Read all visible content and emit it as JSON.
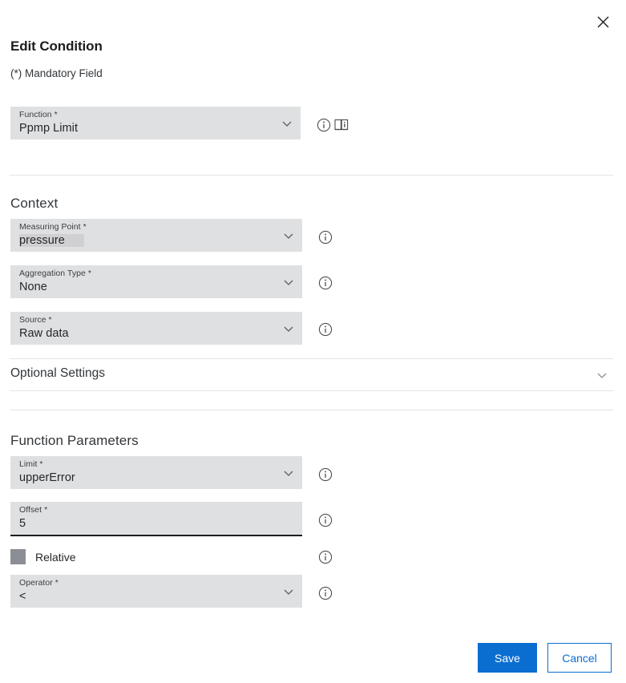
{
  "dialog": {
    "title": "Edit Condition",
    "mandatory_note": "(*) Mandatory Field",
    "close_label": "Close"
  },
  "function_field": {
    "label": "Function *",
    "value": "Ppmp Limit",
    "info_icon": "info-icon",
    "doc_icon": "documentation-book-icon"
  },
  "context": {
    "heading": "Context",
    "fields": [
      {
        "label": "Measuring Point *",
        "value": "pressure",
        "selected": true
      },
      {
        "label": "Aggregation Type *",
        "value": "None",
        "selected": false
      },
      {
        "label": "Source *",
        "value": "Raw data",
        "selected": false
      }
    ]
  },
  "optional_settings": {
    "label": "Optional Settings",
    "expanded": false,
    "chevron_icon": "chevron-down-icon"
  },
  "function_parameters": {
    "heading": "Function Parameters",
    "limit": {
      "label": "Limit *",
      "value": "upperError"
    },
    "offset": {
      "label": "Offset *",
      "value": "5"
    },
    "relative": {
      "label": "Relative",
      "checked": false
    },
    "operator": {
      "label": "Operator *",
      "value": "<"
    }
  },
  "footer": {
    "save_label": "Save",
    "cancel_label": "Cancel"
  },
  "colors": {
    "accent": "#0a6ed1",
    "field_bg": "#dfe0e2",
    "text": "#32363a",
    "divider": "#e4e4e6",
    "checkbox_disabled": "#8b8e94"
  }
}
